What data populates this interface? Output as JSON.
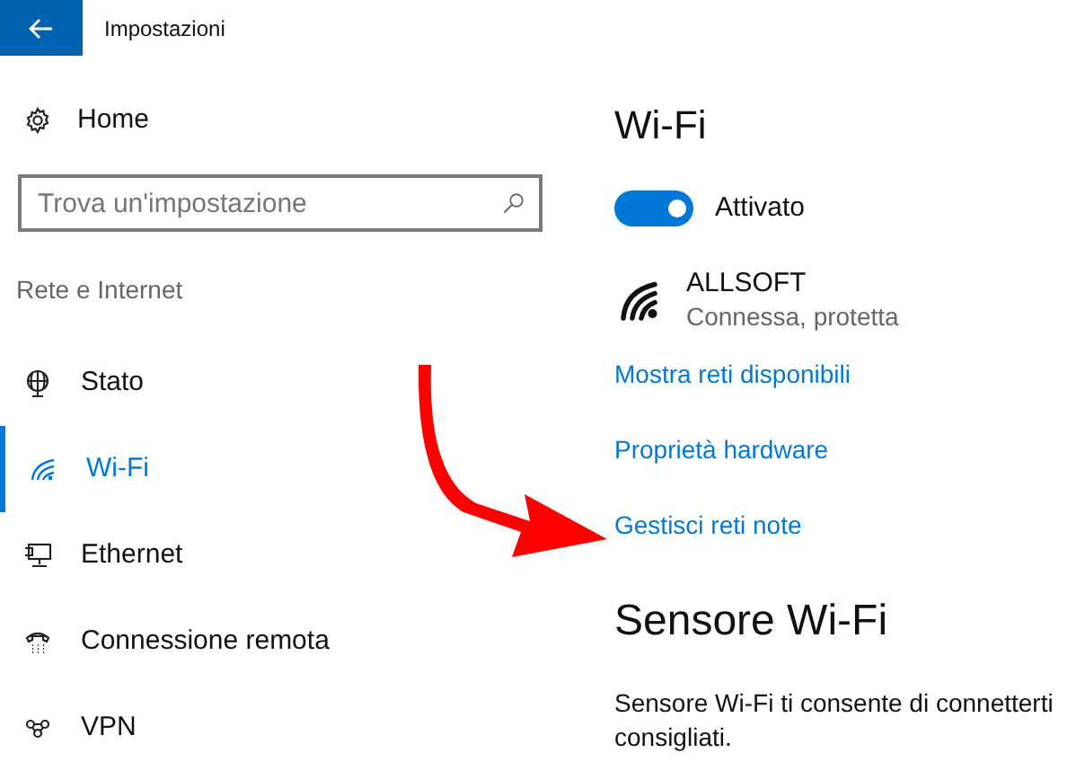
{
  "window": {
    "title": "Impostazioni"
  },
  "sidebar": {
    "home": "Home",
    "search": {
      "placeholder": "Trova un'impostazione"
    },
    "section": "Rete e Internet",
    "items": [
      {
        "label": "Stato",
        "kind": "globe",
        "selected": false
      },
      {
        "label": "Wi-Fi",
        "kind": "wifi",
        "selected": true
      },
      {
        "label": "Ethernet",
        "kind": "ethernet",
        "selected": false
      },
      {
        "label": "Connessione remota",
        "kind": "phone",
        "selected": false
      },
      {
        "label": "VPN",
        "kind": "vpn",
        "selected": false
      }
    ]
  },
  "content": {
    "heading": "Wi-Fi",
    "toggle": {
      "on": true,
      "label": "Attivato"
    },
    "network": {
      "name": "ALLSOFT",
      "status": "Connessa, protetta"
    },
    "links": [
      "Mostra reti disponibili",
      "Proprietà hardware",
      "Gestisci reti note"
    ],
    "sensor": {
      "heading": "Sensore Wi-Fi",
      "lines": [
        "Sensore Wi-Fi ti consente di connetterti",
        "consigliati."
      ]
    }
  }
}
